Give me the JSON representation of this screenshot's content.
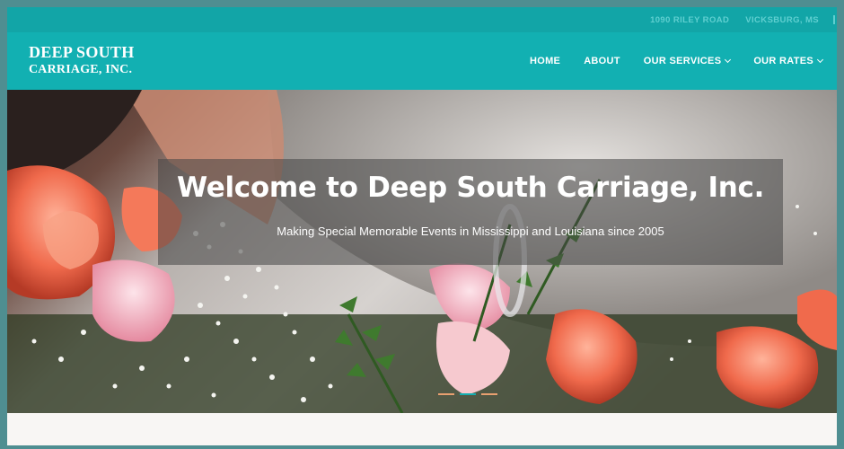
{
  "topbar": {
    "address": "1090 RILEY ROAD",
    "city": "VICKSBURG, MS"
  },
  "brand": {
    "line1": "DEEP SOUTH",
    "line2": "CARRIAGE, INC."
  },
  "nav": {
    "home": "HOME",
    "about": "ABOUT",
    "services": "OUR SERVICES",
    "rates": "OUR RATES"
  },
  "hero": {
    "title": "Welcome to Deep South Carriage, Inc.",
    "subtitle": "Making Special Memorable Events in Mississippi and Louisiana since 2005",
    "image_icon": "wedding-flowers-photo",
    "slides_total": 3,
    "slide_active": 2
  },
  "colors": {
    "outer": "#4f8e91",
    "topbar": "#12a5a7",
    "navbar": "#12b0b2",
    "accent": "#13aeb0"
  }
}
